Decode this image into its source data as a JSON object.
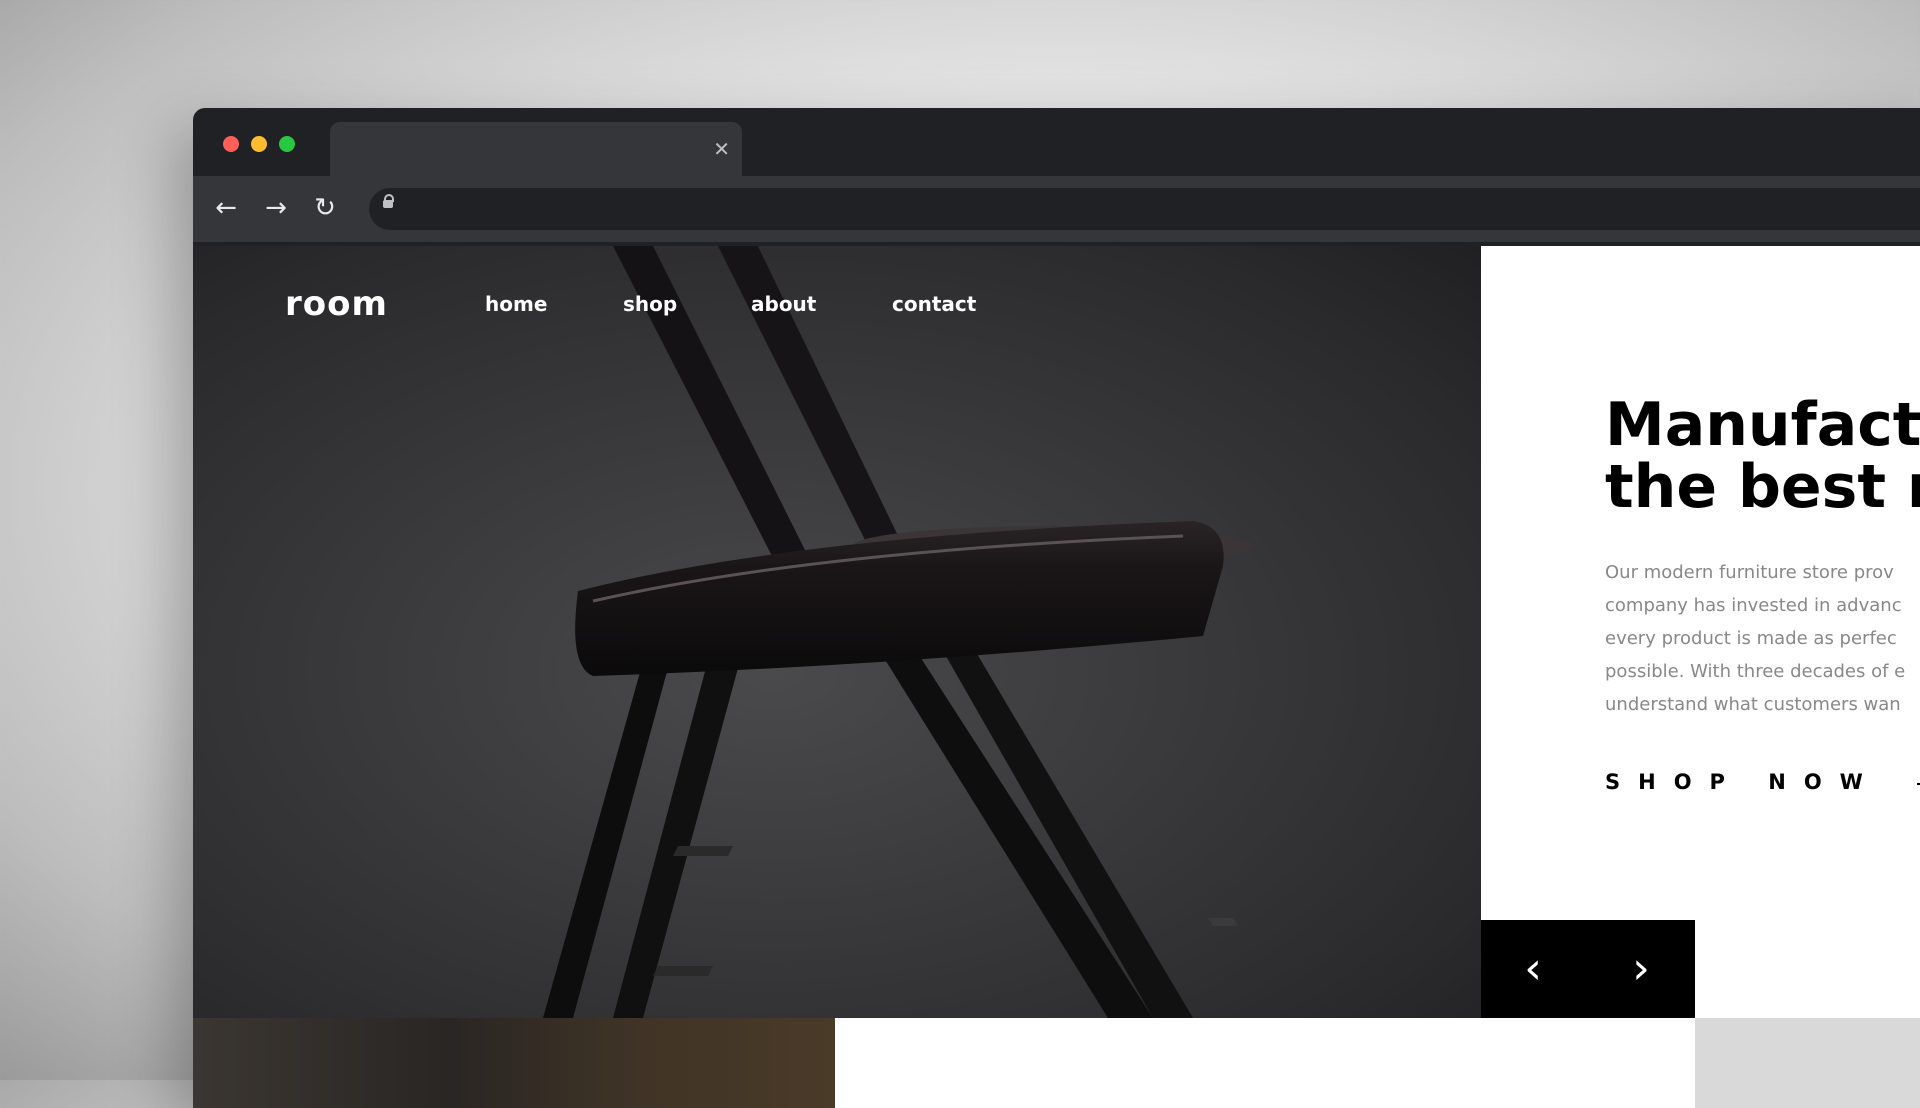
{
  "browser": {
    "tab": {
      "close_icon": "close-icon"
    },
    "toolbar": {
      "back_icon": "arrow-left-icon",
      "forward_icon": "arrow-right-icon",
      "reload_icon": "reload-icon",
      "lock_icon": "lock-icon"
    }
  },
  "site": {
    "logo": "room",
    "nav": [
      {
        "label": "home"
      },
      {
        "label": "shop"
      },
      {
        "label": "about"
      },
      {
        "label": "contact"
      }
    ],
    "hero": {
      "headline_line1": "Manufactu",
      "headline_line2": "the best m",
      "description": [
        "Our modern furniture store prov",
        "company has invested in advanc",
        "every product is made as perfec",
        "possible. With three decades of e",
        "understand what customers wan"
      ],
      "cta": "SHOP NOW"
    },
    "slider": {
      "prev_icon": "chevron-left-icon",
      "next_icon": "chevron-right-icon"
    }
  },
  "colors": {
    "chrome_dark": "#202124",
    "chrome_toolbar": "#35363a",
    "hero_dark": "#3a3a3c",
    "slider_bg": "#000000",
    "text_muted": "#888888"
  }
}
